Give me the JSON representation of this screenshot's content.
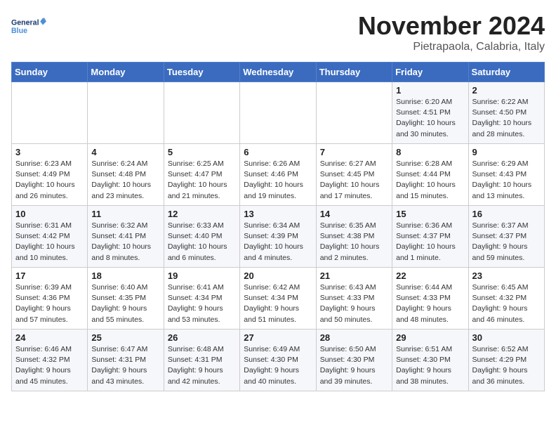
{
  "logo": {
    "line1": "General",
    "line2": "Blue"
  },
  "title": "November 2024",
  "subtitle": "Pietrapaola, Calabria, Italy",
  "weekdays": [
    "Sunday",
    "Monday",
    "Tuesday",
    "Wednesday",
    "Thursday",
    "Friday",
    "Saturday"
  ],
  "weeks": [
    [
      {
        "day": "",
        "info": ""
      },
      {
        "day": "",
        "info": ""
      },
      {
        "day": "",
        "info": ""
      },
      {
        "day": "",
        "info": ""
      },
      {
        "day": "",
        "info": ""
      },
      {
        "day": "1",
        "info": "Sunrise: 6:20 AM\nSunset: 4:51 PM\nDaylight: 10 hours and 30 minutes."
      },
      {
        "day": "2",
        "info": "Sunrise: 6:22 AM\nSunset: 4:50 PM\nDaylight: 10 hours and 28 minutes."
      }
    ],
    [
      {
        "day": "3",
        "info": "Sunrise: 6:23 AM\nSunset: 4:49 PM\nDaylight: 10 hours and 26 minutes."
      },
      {
        "day": "4",
        "info": "Sunrise: 6:24 AM\nSunset: 4:48 PM\nDaylight: 10 hours and 23 minutes."
      },
      {
        "day": "5",
        "info": "Sunrise: 6:25 AM\nSunset: 4:47 PM\nDaylight: 10 hours and 21 minutes."
      },
      {
        "day": "6",
        "info": "Sunrise: 6:26 AM\nSunset: 4:46 PM\nDaylight: 10 hours and 19 minutes."
      },
      {
        "day": "7",
        "info": "Sunrise: 6:27 AM\nSunset: 4:45 PM\nDaylight: 10 hours and 17 minutes."
      },
      {
        "day": "8",
        "info": "Sunrise: 6:28 AM\nSunset: 4:44 PM\nDaylight: 10 hours and 15 minutes."
      },
      {
        "day": "9",
        "info": "Sunrise: 6:29 AM\nSunset: 4:43 PM\nDaylight: 10 hours and 13 minutes."
      }
    ],
    [
      {
        "day": "10",
        "info": "Sunrise: 6:31 AM\nSunset: 4:42 PM\nDaylight: 10 hours and 10 minutes."
      },
      {
        "day": "11",
        "info": "Sunrise: 6:32 AM\nSunset: 4:41 PM\nDaylight: 10 hours and 8 minutes."
      },
      {
        "day": "12",
        "info": "Sunrise: 6:33 AM\nSunset: 4:40 PM\nDaylight: 10 hours and 6 minutes."
      },
      {
        "day": "13",
        "info": "Sunrise: 6:34 AM\nSunset: 4:39 PM\nDaylight: 10 hours and 4 minutes."
      },
      {
        "day": "14",
        "info": "Sunrise: 6:35 AM\nSunset: 4:38 PM\nDaylight: 10 hours and 2 minutes."
      },
      {
        "day": "15",
        "info": "Sunrise: 6:36 AM\nSunset: 4:37 PM\nDaylight: 10 hours and 1 minute."
      },
      {
        "day": "16",
        "info": "Sunrise: 6:37 AM\nSunset: 4:37 PM\nDaylight: 9 hours and 59 minutes."
      }
    ],
    [
      {
        "day": "17",
        "info": "Sunrise: 6:39 AM\nSunset: 4:36 PM\nDaylight: 9 hours and 57 minutes."
      },
      {
        "day": "18",
        "info": "Sunrise: 6:40 AM\nSunset: 4:35 PM\nDaylight: 9 hours and 55 minutes."
      },
      {
        "day": "19",
        "info": "Sunrise: 6:41 AM\nSunset: 4:34 PM\nDaylight: 9 hours and 53 minutes."
      },
      {
        "day": "20",
        "info": "Sunrise: 6:42 AM\nSunset: 4:34 PM\nDaylight: 9 hours and 51 minutes."
      },
      {
        "day": "21",
        "info": "Sunrise: 6:43 AM\nSunset: 4:33 PM\nDaylight: 9 hours and 50 minutes."
      },
      {
        "day": "22",
        "info": "Sunrise: 6:44 AM\nSunset: 4:33 PM\nDaylight: 9 hours and 48 minutes."
      },
      {
        "day": "23",
        "info": "Sunrise: 6:45 AM\nSunset: 4:32 PM\nDaylight: 9 hours and 46 minutes."
      }
    ],
    [
      {
        "day": "24",
        "info": "Sunrise: 6:46 AM\nSunset: 4:32 PM\nDaylight: 9 hours and 45 minutes."
      },
      {
        "day": "25",
        "info": "Sunrise: 6:47 AM\nSunset: 4:31 PM\nDaylight: 9 hours and 43 minutes."
      },
      {
        "day": "26",
        "info": "Sunrise: 6:48 AM\nSunset: 4:31 PM\nDaylight: 9 hours and 42 minutes."
      },
      {
        "day": "27",
        "info": "Sunrise: 6:49 AM\nSunset: 4:30 PM\nDaylight: 9 hours and 40 minutes."
      },
      {
        "day": "28",
        "info": "Sunrise: 6:50 AM\nSunset: 4:30 PM\nDaylight: 9 hours and 39 minutes."
      },
      {
        "day": "29",
        "info": "Sunrise: 6:51 AM\nSunset: 4:30 PM\nDaylight: 9 hours and 38 minutes."
      },
      {
        "day": "30",
        "info": "Sunrise: 6:52 AM\nSunset: 4:29 PM\nDaylight: 9 hours and 36 minutes."
      }
    ]
  ]
}
